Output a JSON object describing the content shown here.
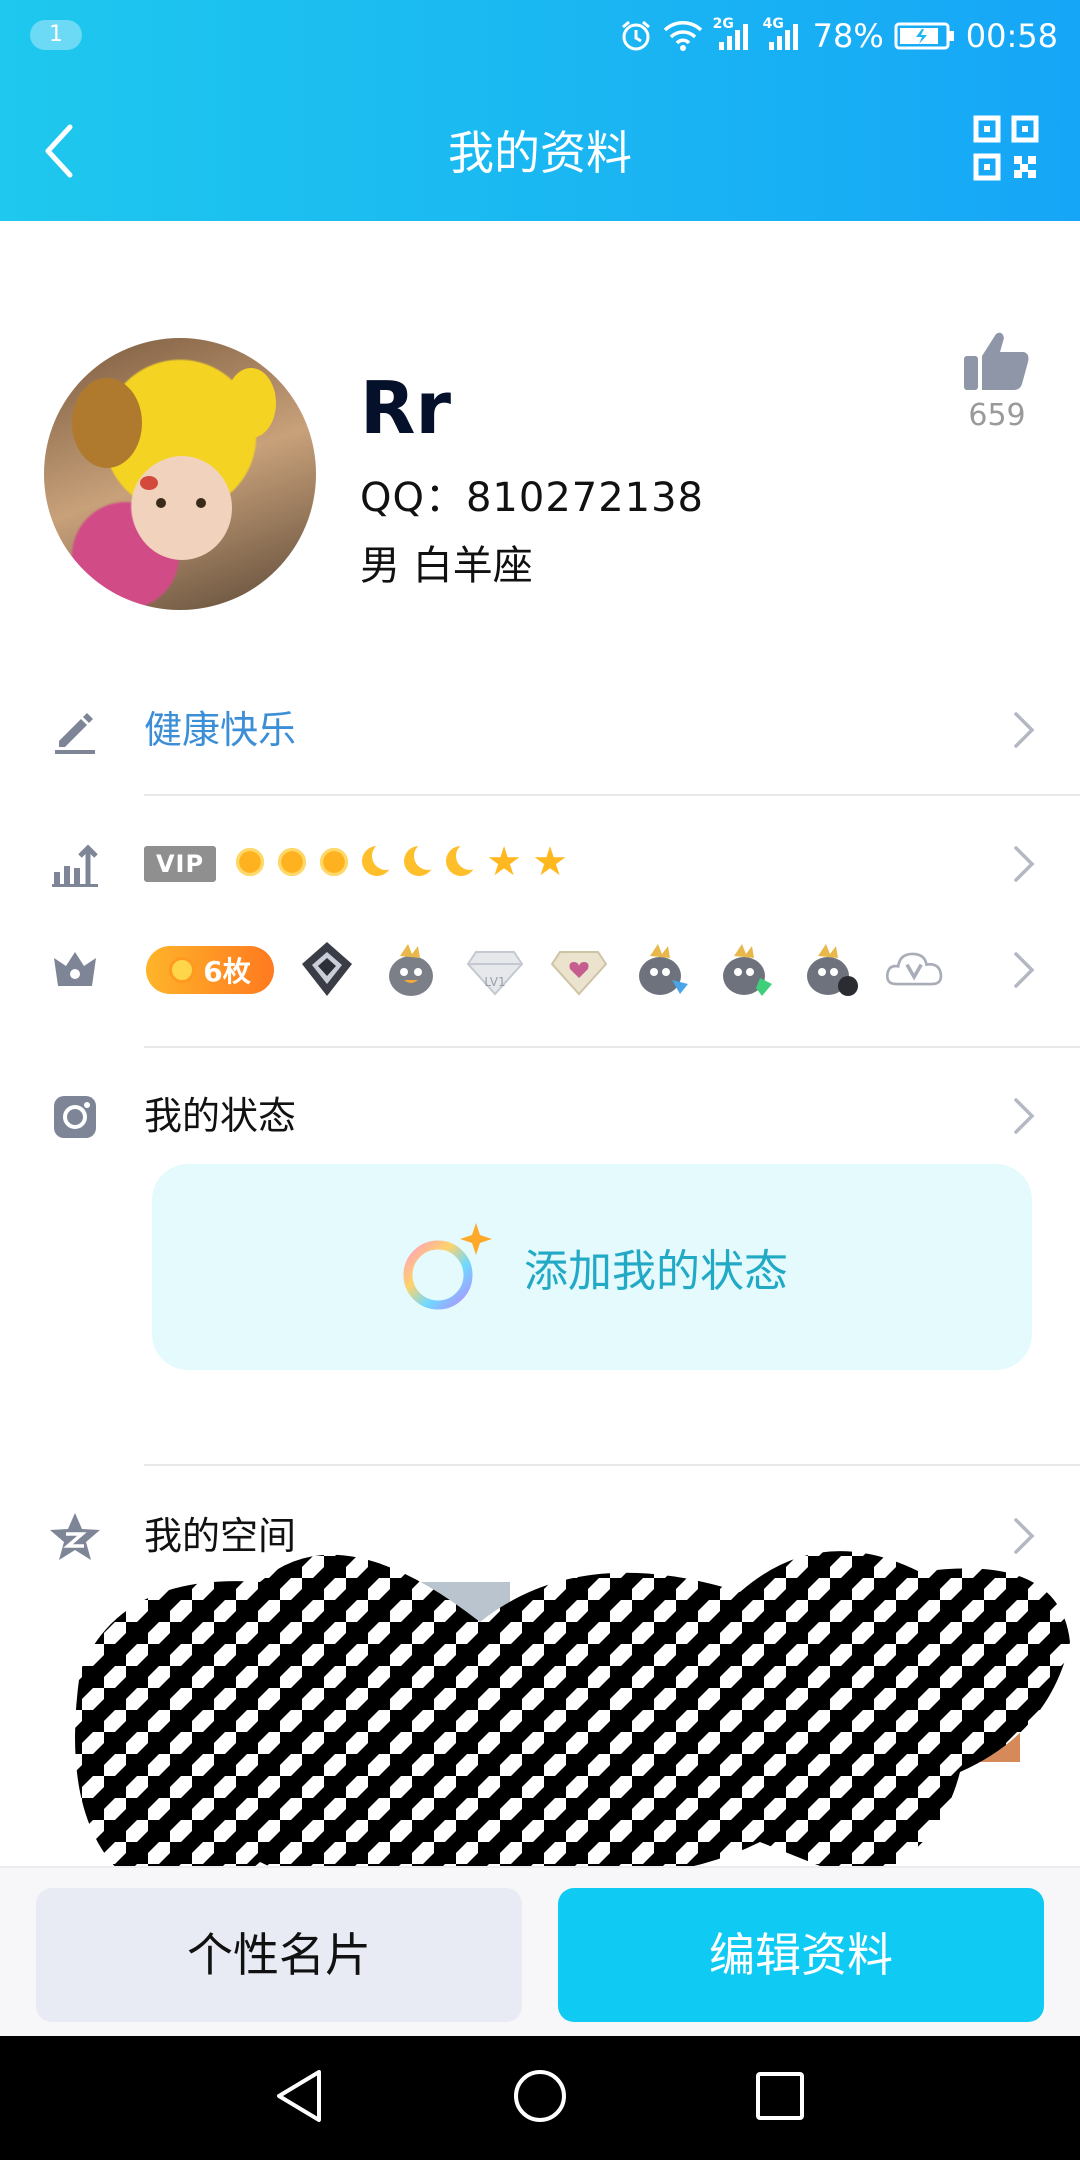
{
  "status_bar": {
    "notification_count": "1",
    "net_2g": "2G",
    "net_4g": "4G",
    "battery": "78%",
    "time": "00:58"
  },
  "nav": {
    "title": "我的资料"
  },
  "profile": {
    "nickname": "Rr",
    "qq": "QQ：810272138",
    "gender_sign": "男  白羊座",
    "likes": "659"
  },
  "signature": {
    "text": "健康快乐"
  },
  "level": {
    "vip_tag": "VIP",
    "icons": [
      "sun",
      "sun",
      "sun",
      "moon",
      "moon",
      "moon",
      "star",
      "star"
    ]
  },
  "medals": {
    "count_label": "6枚",
    "badges": [
      "dark-diamond-badge-icon",
      "penguin-badge-icon",
      "lv1-diamond-badge-icon",
      "heart-diamond-badge-icon",
      "penguin-blue-badge-icon",
      "penguin-green-badge-icon",
      "penguin-black-badge-icon",
      "cloud-v-badge-icon"
    ]
  },
  "my_status": {
    "label": "我的状态",
    "add_label": "添加我的状态"
  },
  "my_space": {
    "label": "我的空间"
  },
  "buttons": {
    "card": "个性名片",
    "edit": "编辑资料"
  },
  "colors": {
    "header_start": "#1ec8ee",
    "header_end": "#16a6f7",
    "accent": "#0fcbf4",
    "signature": "#3c8fd6"
  }
}
